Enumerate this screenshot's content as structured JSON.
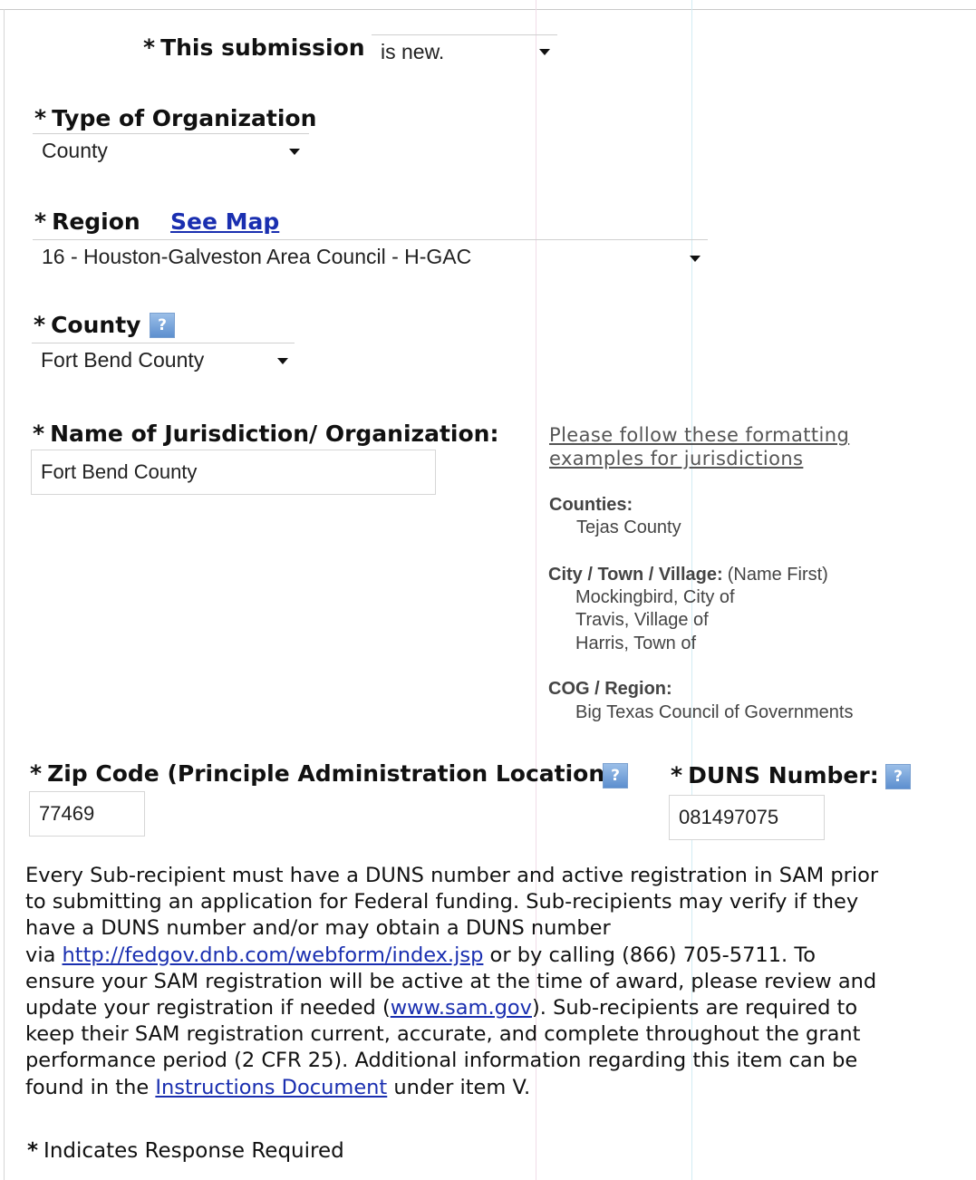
{
  "submission": {
    "label": "This submission",
    "value": "is new."
  },
  "org_type": {
    "label": "Type of Organization",
    "value": "County"
  },
  "region": {
    "label": "Region",
    "see_map": "See Map",
    "value": "16 - Houston-Galveston Area Council - H-GAC"
  },
  "county": {
    "label": "County",
    "value": "Fort Bend County"
  },
  "jurisdiction": {
    "label": "Name of Jurisdiction/ Organization:",
    "value": "Fort Bend County"
  },
  "formatting": {
    "link_line1": "Please follow these formatting",
    "link_line2": "examples for jurisdictions",
    "counties_heading": "Counties:",
    "counties_example": "Tejas County",
    "city_heading": "City / Town / Village:",
    "city_note": "(Name First)",
    "city_examples": [
      "Mockingbird, City of",
      "Travis, Village of",
      "Harris, Town of"
    ],
    "cog_heading": "COG / Region:",
    "cog_example": "Big Texas Council of Governments"
  },
  "zip": {
    "label": "Zip Code (Principle Administration Location)",
    "value": "77469"
  },
  "duns": {
    "label": "DUNS Number:",
    "value": "081497075"
  },
  "help_glyph": "?",
  "asterisk": "*",
  "duns_notice": {
    "line1": "Every Sub-recipient must have a DUNS number and active registration in SAM prior",
    "line2": "to submitting an application for Federal funding. Sub-recipients may verify if they",
    "line3": "have a DUNS number and/or may obtain a DUNS number",
    "line4_pre": "via ",
    "line4_link": "http://fedgov.dnb.com/webform/index.jsp",
    "line4_post": " or by calling (866) 705-5711. To",
    "line5": "ensure your SAM registration will be active at the time of award, please review and",
    "line6_pre": "update your registration if needed (",
    "line6_link": "www.sam.gov",
    "line6_post": "). Sub-recipients are required to",
    "line7": "keep their SAM registration current, accurate, and complete throughout the grant",
    "line8": "performance period (2 CFR 25).  Additional information regarding this item can be",
    "line9_pre": "found in the ",
    "line9_link": "Instructions Document",
    "line9_post": " under item V."
  },
  "required_note": "Indicates Response Required",
  "colors": {
    "link": "#1a2fb0",
    "help_icon": "#5d8fcf"
  }
}
